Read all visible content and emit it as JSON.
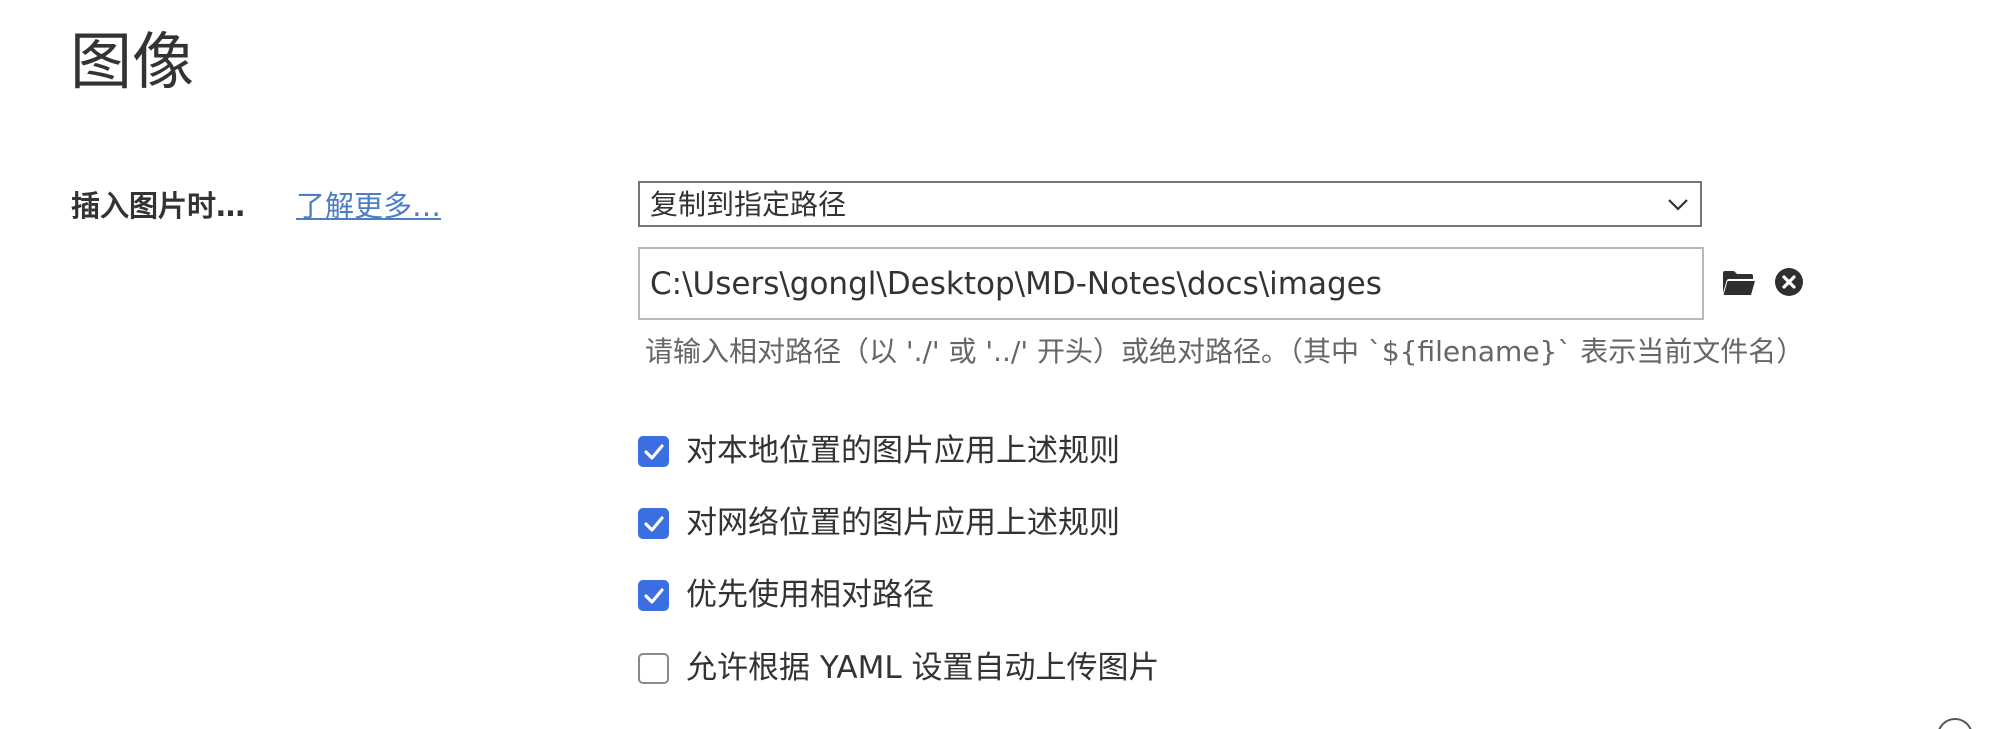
{
  "section": {
    "title": "图像"
  },
  "insert_image": {
    "label": "插入图片时…",
    "learn_more": "了解更多…",
    "action_select": {
      "value": "复制到指定路径",
      "icon": "chevron-down-icon"
    },
    "path_input": {
      "value": "C:\\Users\\gongl\\Desktop\\MD-Notes\\docs\\images",
      "folder_icon": "folder-icon",
      "clear_icon": "clear-icon"
    },
    "hint": "请输入相对路径（以 './' 或 '../' 开头）或绝对路径。（其中 `${filename}` 表示当前文件名）"
  },
  "options": [
    {
      "label": "对本地位置的图片应用上述规则",
      "checked": true
    },
    {
      "label": "对网络位置的图片应用上述规则",
      "checked": true
    },
    {
      "label": "优先使用相对路径",
      "checked": true
    },
    {
      "label": "允许根据 YAML 设置自动上传图片",
      "checked": false
    }
  ],
  "colors": {
    "accent": "#3b6fe0",
    "link": "#4b7ec6",
    "text": "#333333",
    "hint": "#666666"
  }
}
